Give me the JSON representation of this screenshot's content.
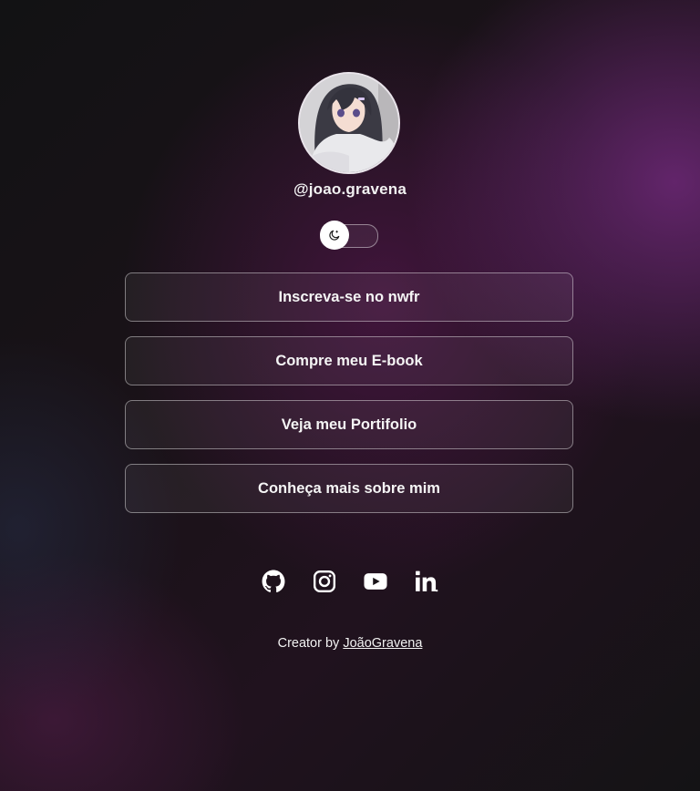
{
  "profile": {
    "username": "@joao.gravena",
    "avatar_icon": "anime-avatar-image"
  },
  "theme_toggle": {
    "icon": "moon-icon",
    "state": "dark"
  },
  "links": [
    {
      "label": "Inscreva-se no nwfr"
    },
    {
      "label": "Compre meu E-book"
    },
    {
      "label": "Veja meu Portifolio"
    },
    {
      "label": "Conheça mais sobre mim"
    }
  ],
  "socials": [
    {
      "icon": "github-icon"
    },
    {
      "icon": "instagram-icon"
    },
    {
      "icon": "youtube-icon"
    },
    {
      "icon": "linkedin-icon"
    }
  ],
  "footer": {
    "prefix": "Creator by",
    "author": "JoãoGravena"
  },
  "colors": {
    "background": "#121214",
    "accent": "#6e2878",
    "text": "#f5f5f5"
  }
}
